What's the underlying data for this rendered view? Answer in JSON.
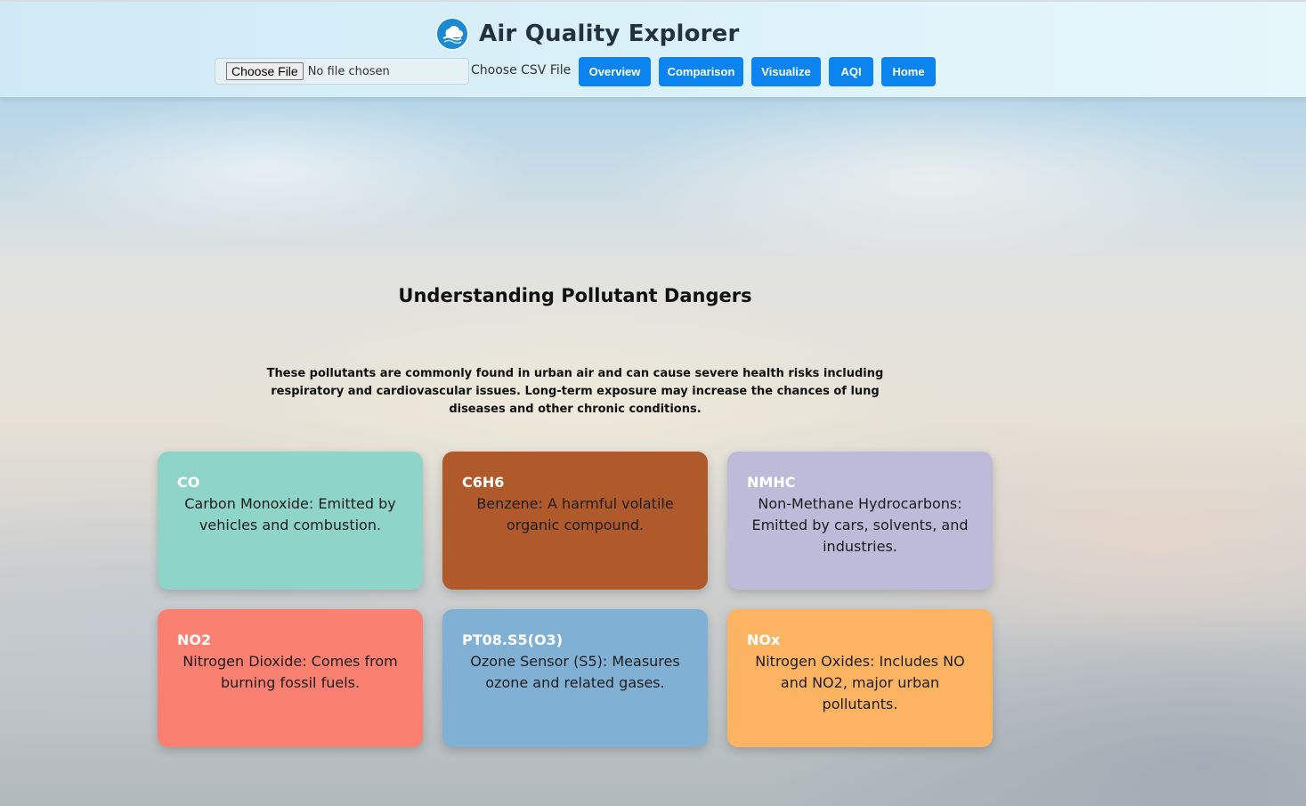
{
  "header": {
    "title": "Air Quality Explorer",
    "file_input": {
      "button_label": "Choose File",
      "status": "No file chosen"
    },
    "csv_label": "Choose CSV File",
    "nav": [
      {
        "label": "Overview"
      },
      {
        "label": "Comparison"
      },
      {
        "label": "Visualize"
      },
      {
        "label": "AQI"
      },
      {
        "label": "Home"
      }
    ],
    "nav_color": "#0b84f0"
  },
  "main": {
    "heading": "Understanding Pollutant Dangers",
    "intro": "These pollutants are commonly found in urban air and can cause severe health risks including respiratory and cardiovascular issues. Long-term exposure may increase the chances of lung diseases and other chronic conditions.",
    "cards": [
      {
        "code": "CO",
        "description": "Carbon Monoxide: Emitted by vehicles and combustion.",
        "color": "#8ed4c8"
      },
      {
        "code": "C6H6",
        "description": "Benzene: A harmful volatile organic compound.",
        "color": "#b0592a"
      },
      {
        "code": "NMHC",
        "description": "Non-Methane Hydrocarbons: Emitted by cars, solvents, and industries.",
        "color": "#bebad9"
      },
      {
        "code": "NO2",
        "description": "Nitrogen Dioxide: Comes from burning fossil fuels.",
        "color": "#fa8072"
      },
      {
        "code": "PT08.S5(O3)",
        "description": "Ozone Sensor (S5): Measures ozone and related gases.",
        "color": "#80b1d4"
      },
      {
        "code": "NOx",
        "description": "Nitrogen Oxides: Includes NO and NO2, major urban pollutants.",
        "color": "#fcb462"
      }
    ]
  }
}
